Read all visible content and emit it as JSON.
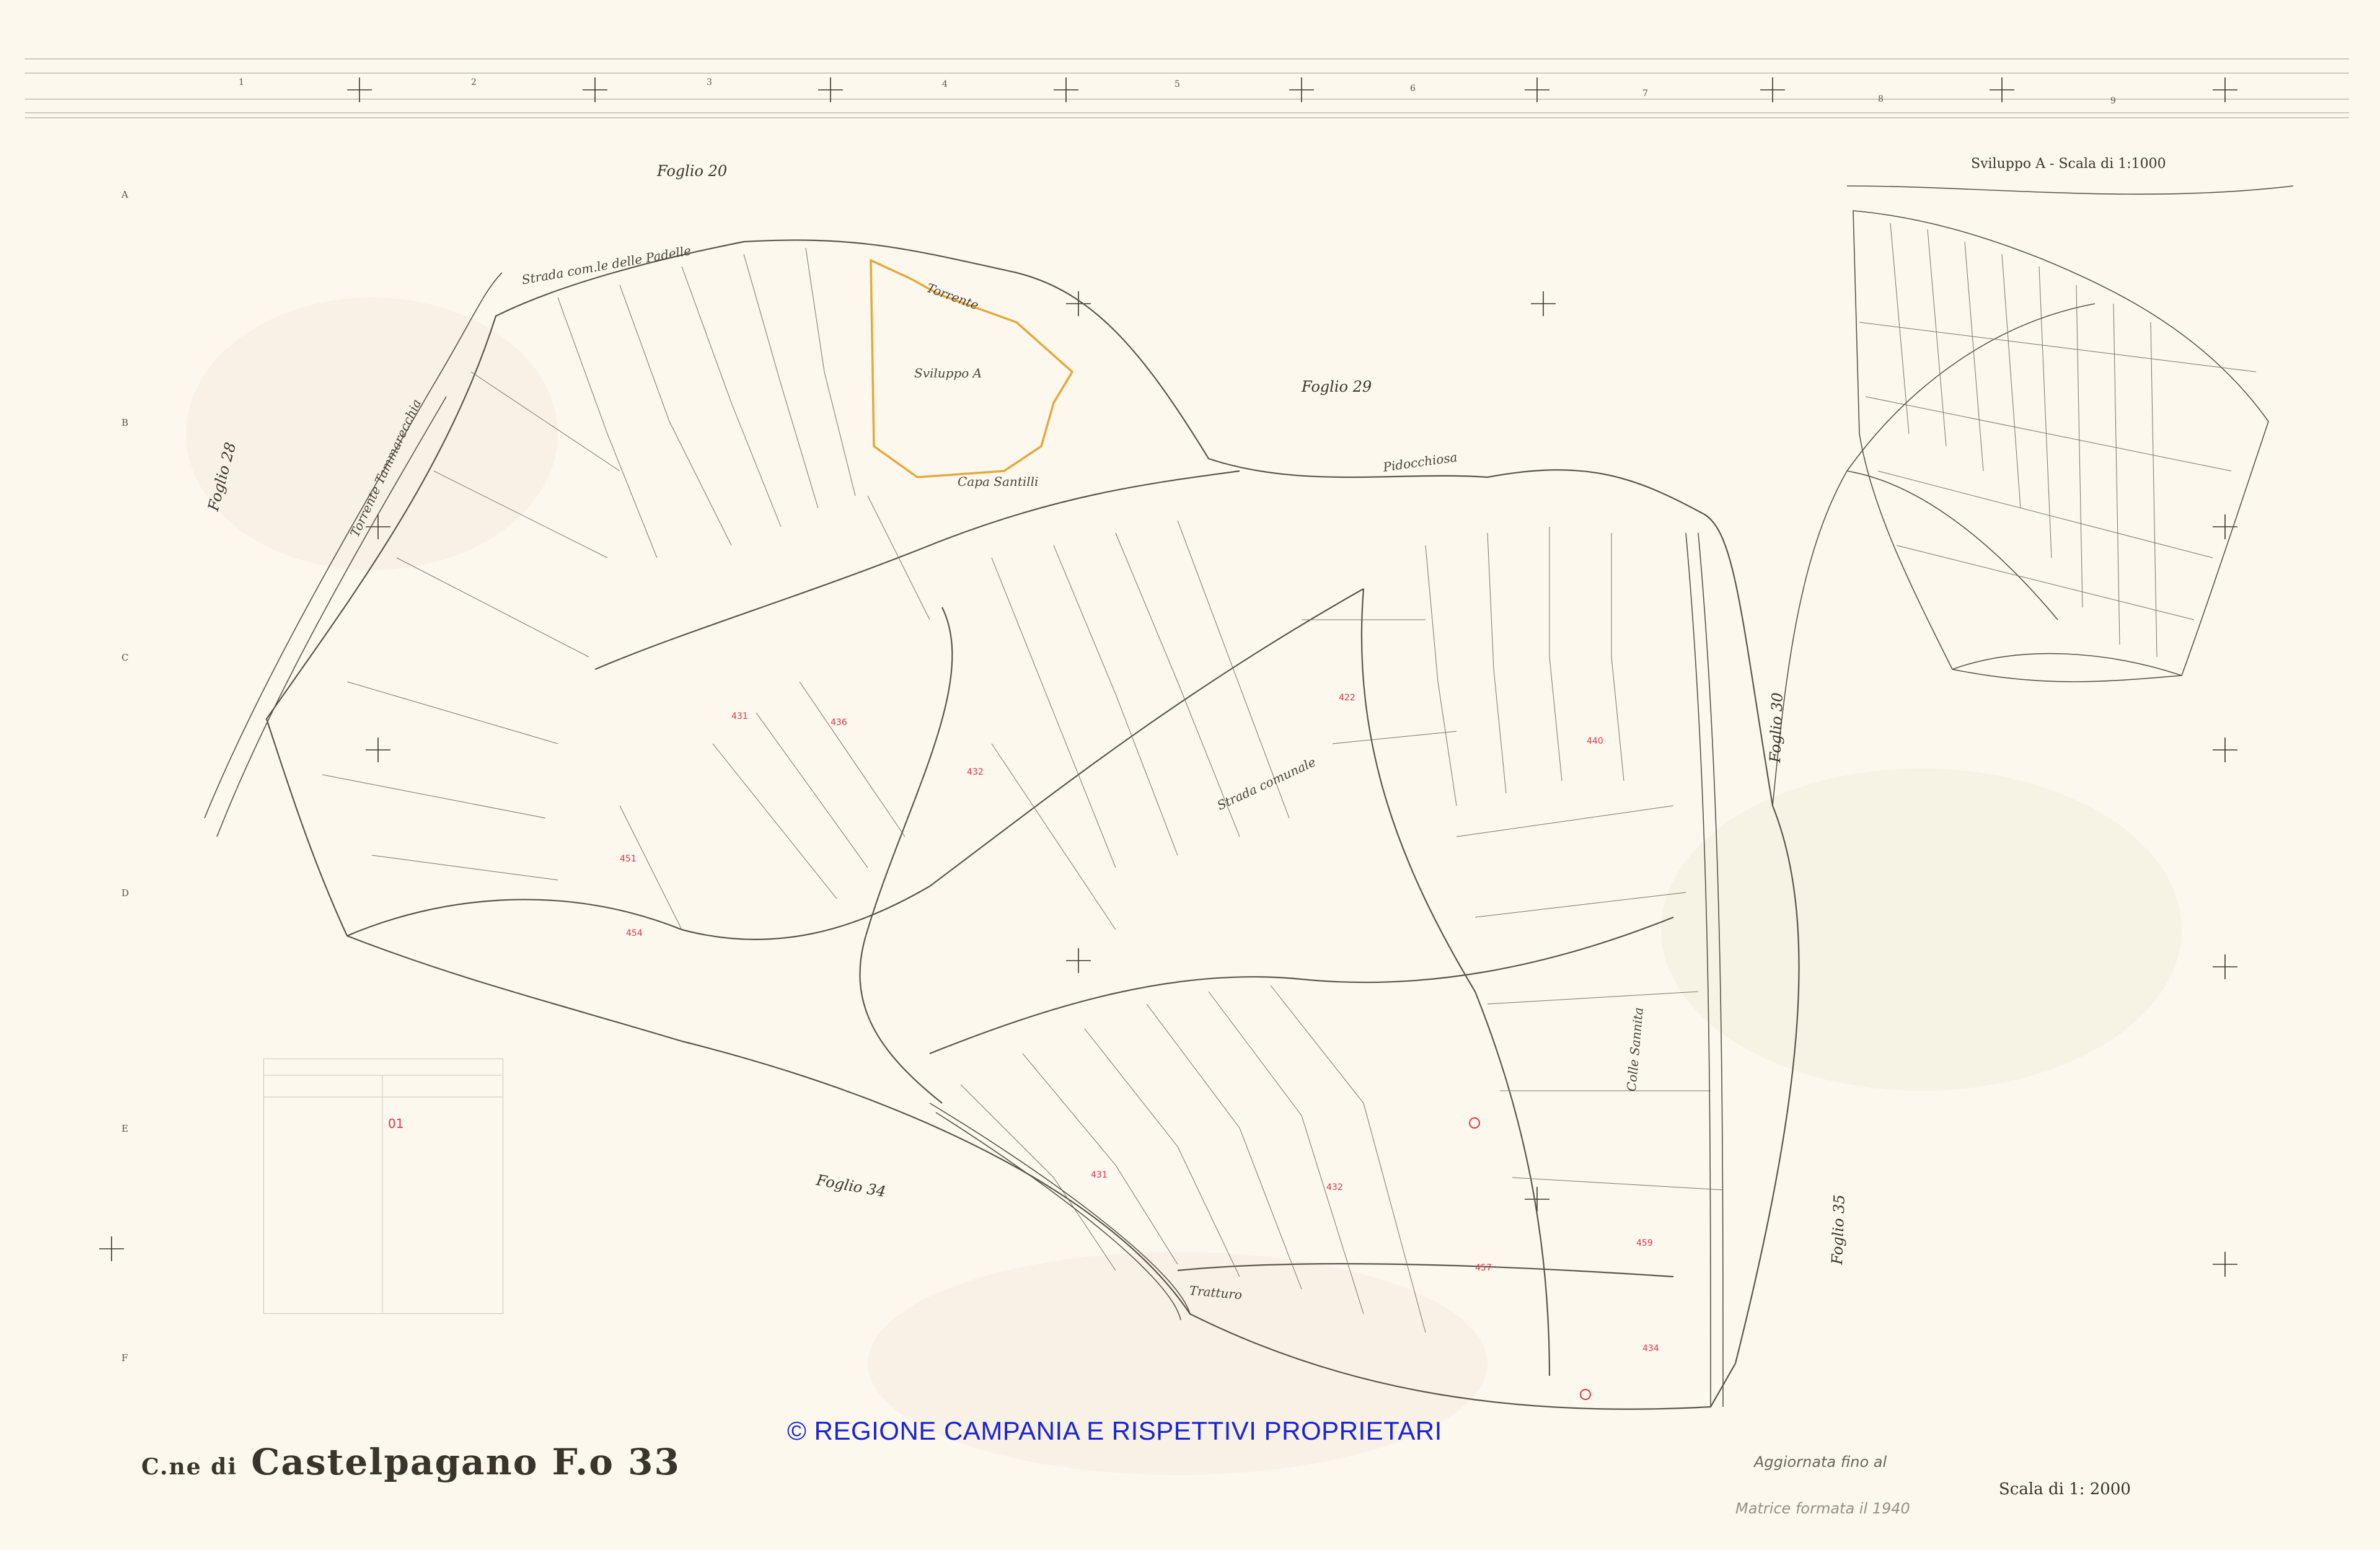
{
  "map": {
    "municipality_prefix": "C.ne di",
    "municipality": "Castelpagano",
    "sheet": "F.o 33",
    "scale_main": "Scala di 1: 2000",
    "scale_dev": "Sviluppo A - Scala di 1:1000",
    "development_label": "Sviluppo A",
    "copyright": "© REGIONE CAMPANIA E RISPETTIVI PROPRIETARI",
    "updated_note": "Aggiornata fino al",
    "matrix_note": "Matrice formata il 1940",
    "legend_note": "01"
  },
  "grid": {
    "columns": [
      "1",
      "2",
      "3",
      "4",
      "5",
      "6",
      "7",
      "8",
      "9"
    ],
    "rows": [
      "A",
      "B",
      "C",
      "D",
      "E",
      "F"
    ]
  },
  "neighbours": [
    "Foglio 20",
    "Foglio 28",
    "Foglio 29",
    "Foglio 30",
    "Foglio 34",
    "Foglio 35"
  ],
  "roads": [
    "Strada com.le delle Padelle",
    "Torrente",
    "Capa Santilli",
    "Pidocchiosa",
    "Strada comunale",
    "Tratturo",
    "Colle Sannita",
    "Torrente Tammarecchia"
  ],
  "colors": {
    "paper": "#fcf8ee",
    "ink": "#3a342c",
    "red_ink": "#d7354a",
    "development_outline": "#e4a93a",
    "copyright": "#1b23d6"
  }
}
